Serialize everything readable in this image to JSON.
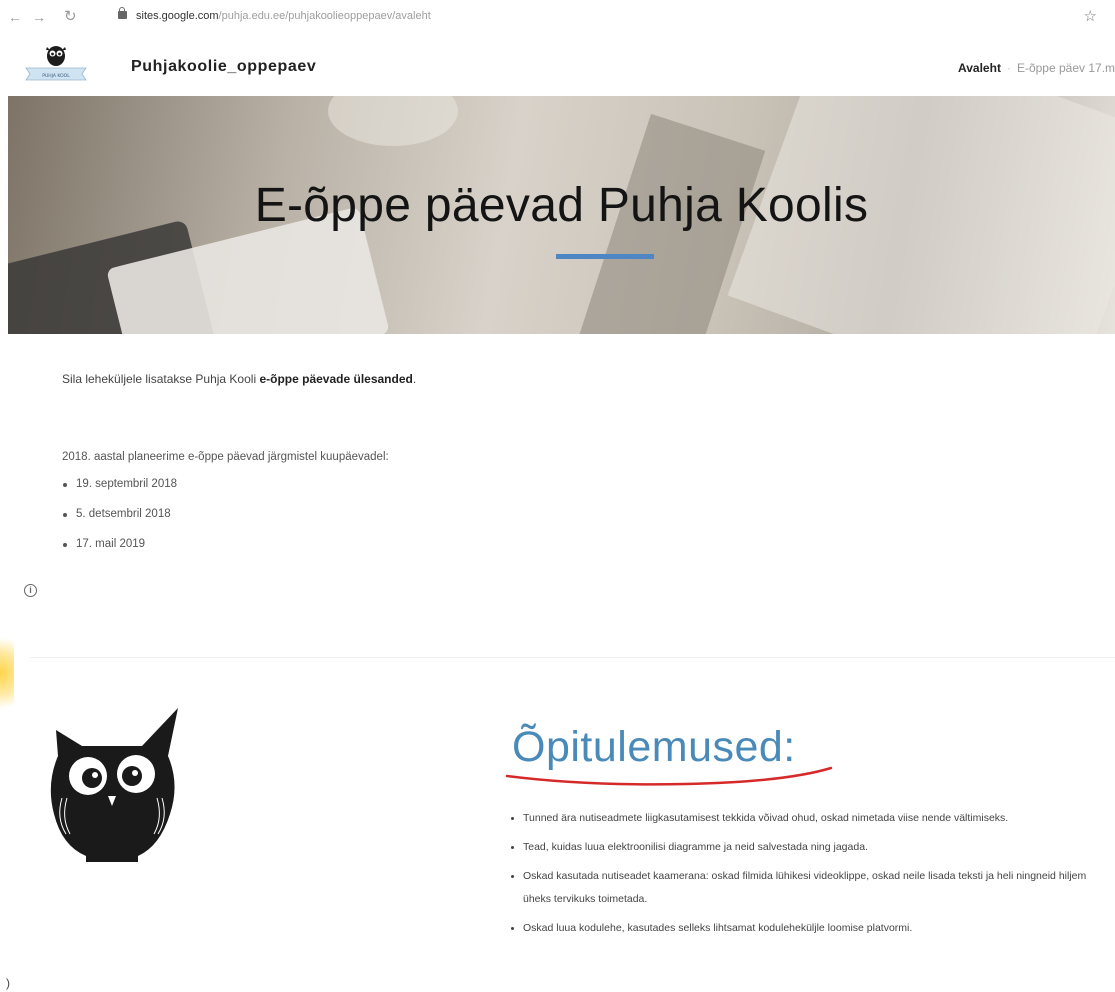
{
  "browser": {
    "url_domain": "sites.google.com",
    "url_path": "/puhja.edu.ee/puhjakoolieoppepaev/avaleht"
  },
  "site": {
    "logo_text": "PUHJA KOOL",
    "title": "Puhjakoolie_oppepaev",
    "nav": {
      "active": "Avaleht",
      "separator": "·",
      "other": "E-õppe päev 17.m"
    }
  },
  "hero": {
    "title": "E-õppe päevad Puhja Koolis"
  },
  "intro": {
    "text_before": "Sila leheküljele lisatakse Puhja Kooli ",
    "text_bold": "e-õppe päevade ülesanded",
    "text_after": "."
  },
  "plan": {
    "heading": "2018. aastal planeerime e-õppe päevad järgmistel kuupäevadel:",
    "dates": [
      "19. septembril 2018",
      "5. detsembril 2018",
      "17. mail 2019"
    ]
  },
  "outcomes": {
    "title": "Õpitulemused:",
    "items": [
      "Tunned ära nutiseadmete liigkasutamisest tekkida võivad ohud, oskad nimetada viise nende vältimiseks.",
      "Tead, kuidas luua elektroonilisi diagramme ja neid salvestada ning jagada.",
      "Oskad kasutada nutiseadet kaamerana: oskad filmida lühikesi videoklippe, oskad neile lisada teksti ja heli ningneid hiljem üheks tervikuks toimetada.",
      "Oskad luua kodulehe, kasutades selleks lihtsamat koduleheküljle loomise platvormi."
    ]
  },
  "edge_char": ")",
  "colors": {
    "accent_line": "#4d86c2",
    "section_title": "#4a8ab9",
    "underline_red": "#d62a2a"
  },
  "icons": [
    "back-arrow-icon",
    "forward-arrow-icon",
    "reload-icon",
    "lock-icon",
    "star-icon",
    "info-icon",
    "owl-logo-icon",
    "owl-illustration"
  ]
}
